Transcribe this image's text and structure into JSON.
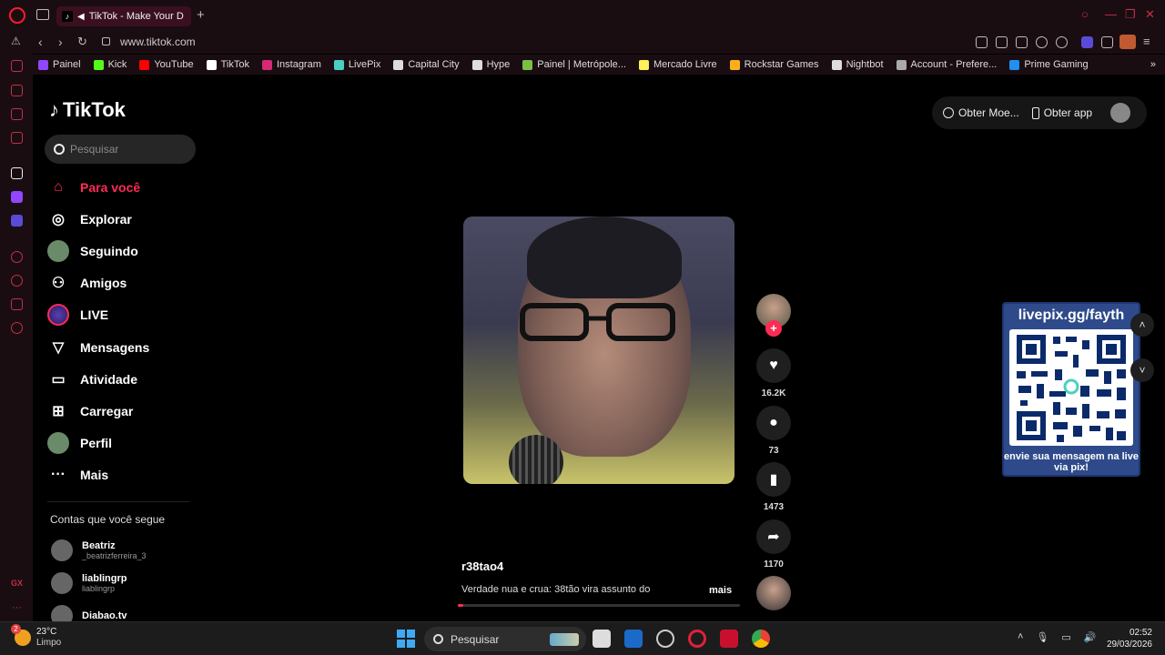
{
  "browser": {
    "tab_title": "TikTok - Make Your D",
    "new_tab": "+",
    "url": "www.tiktok.com",
    "bookmarks": [
      {
        "label": "Painel",
        "color": "#9146ff"
      },
      {
        "label": "Kick",
        "color": "#53fc18"
      },
      {
        "label": "YouTube",
        "color": "#ff0000"
      },
      {
        "label": "TikTok",
        "color": "#ffffff"
      },
      {
        "label": "Instagram",
        "color": "#d62976"
      },
      {
        "label": "LivePix",
        "color": "#4ad0c0"
      },
      {
        "label": "Capital City",
        "color": "#dddddd"
      },
      {
        "label": "Hype",
        "color": "#dddddd"
      },
      {
        "label": "Painel | Metrópole...",
        "color": "#7ac143"
      },
      {
        "label": "Mercado Livre",
        "color": "#fff159"
      },
      {
        "label": "Rockstar Games",
        "color": "#fcaf17"
      },
      {
        "label": "Nightbot",
        "color": "#dddddd"
      },
      {
        "label": "Account - Prefere...",
        "color": "#aaaaaa"
      },
      {
        "label": "Prime Gaming",
        "color": "#1f8ff0"
      }
    ]
  },
  "tiktok": {
    "logo_text": "TikTok",
    "search_placeholder": "Pesquisar",
    "nav": [
      {
        "label": "Para você",
        "icon": "home-icon",
        "active": true
      },
      {
        "label": "Explorar",
        "icon": "compass-icon"
      },
      {
        "label": "Seguindo",
        "icon": "following-avatar-icon"
      },
      {
        "label": "Amigos",
        "icon": "friends-icon"
      },
      {
        "label": "LIVE",
        "icon": "live-icon"
      },
      {
        "label": "Mensagens",
        "icon": "send-icon"
      },
      {
        "label": "Atividade",
        "icon": "activity-icon"
      },
      {
        "label": "Carregar",
        "icon": "upload-icon"
      },
      {
        "label": "Perfil",
        "icon": "profile-avatar-icon"
      },
      {
        "label": "Mais",
        "icon": "more-icon"
      }
    ],
    "following_title": "Contas que você segue",
    "following": [
      {
        "name": "Beatriz",
        "handle": "_beatrizferreira_3"
      },
      {
        "name": "liablingrp",
        "handle": "liablingrp"
      },
      {
        "name": "Diabao.tv",
        "handle": ""
      }
    ],
    "top_right": {
      "coins": "Obter Moe...",
      "app": "Obter app"
    },
    "video": {
      "author": "r38tao4",
      "caption": "Verdade nua e crua: 38tão vira assunto do",
      "more": "mais",
      "progress": 0.02
    },
    "actions": {
      "likes": "16.2K",
      "comments": "73",
      "saves": "1473",
      "shares": "1170"
    },
    "overlay": {
      "title": "livepix.gg/fayth",
      "caption": "envie sua mensagem na live via pix!"
    }
  },
  "taskbar": {
    "weather_temp": "23°C",
    "weather_desc": "Limpo",
    "weather_badge": "2",
    "search": "Pesquisar",
    "time": "02:52",
    "date": "29/03/2026"
  }
}
